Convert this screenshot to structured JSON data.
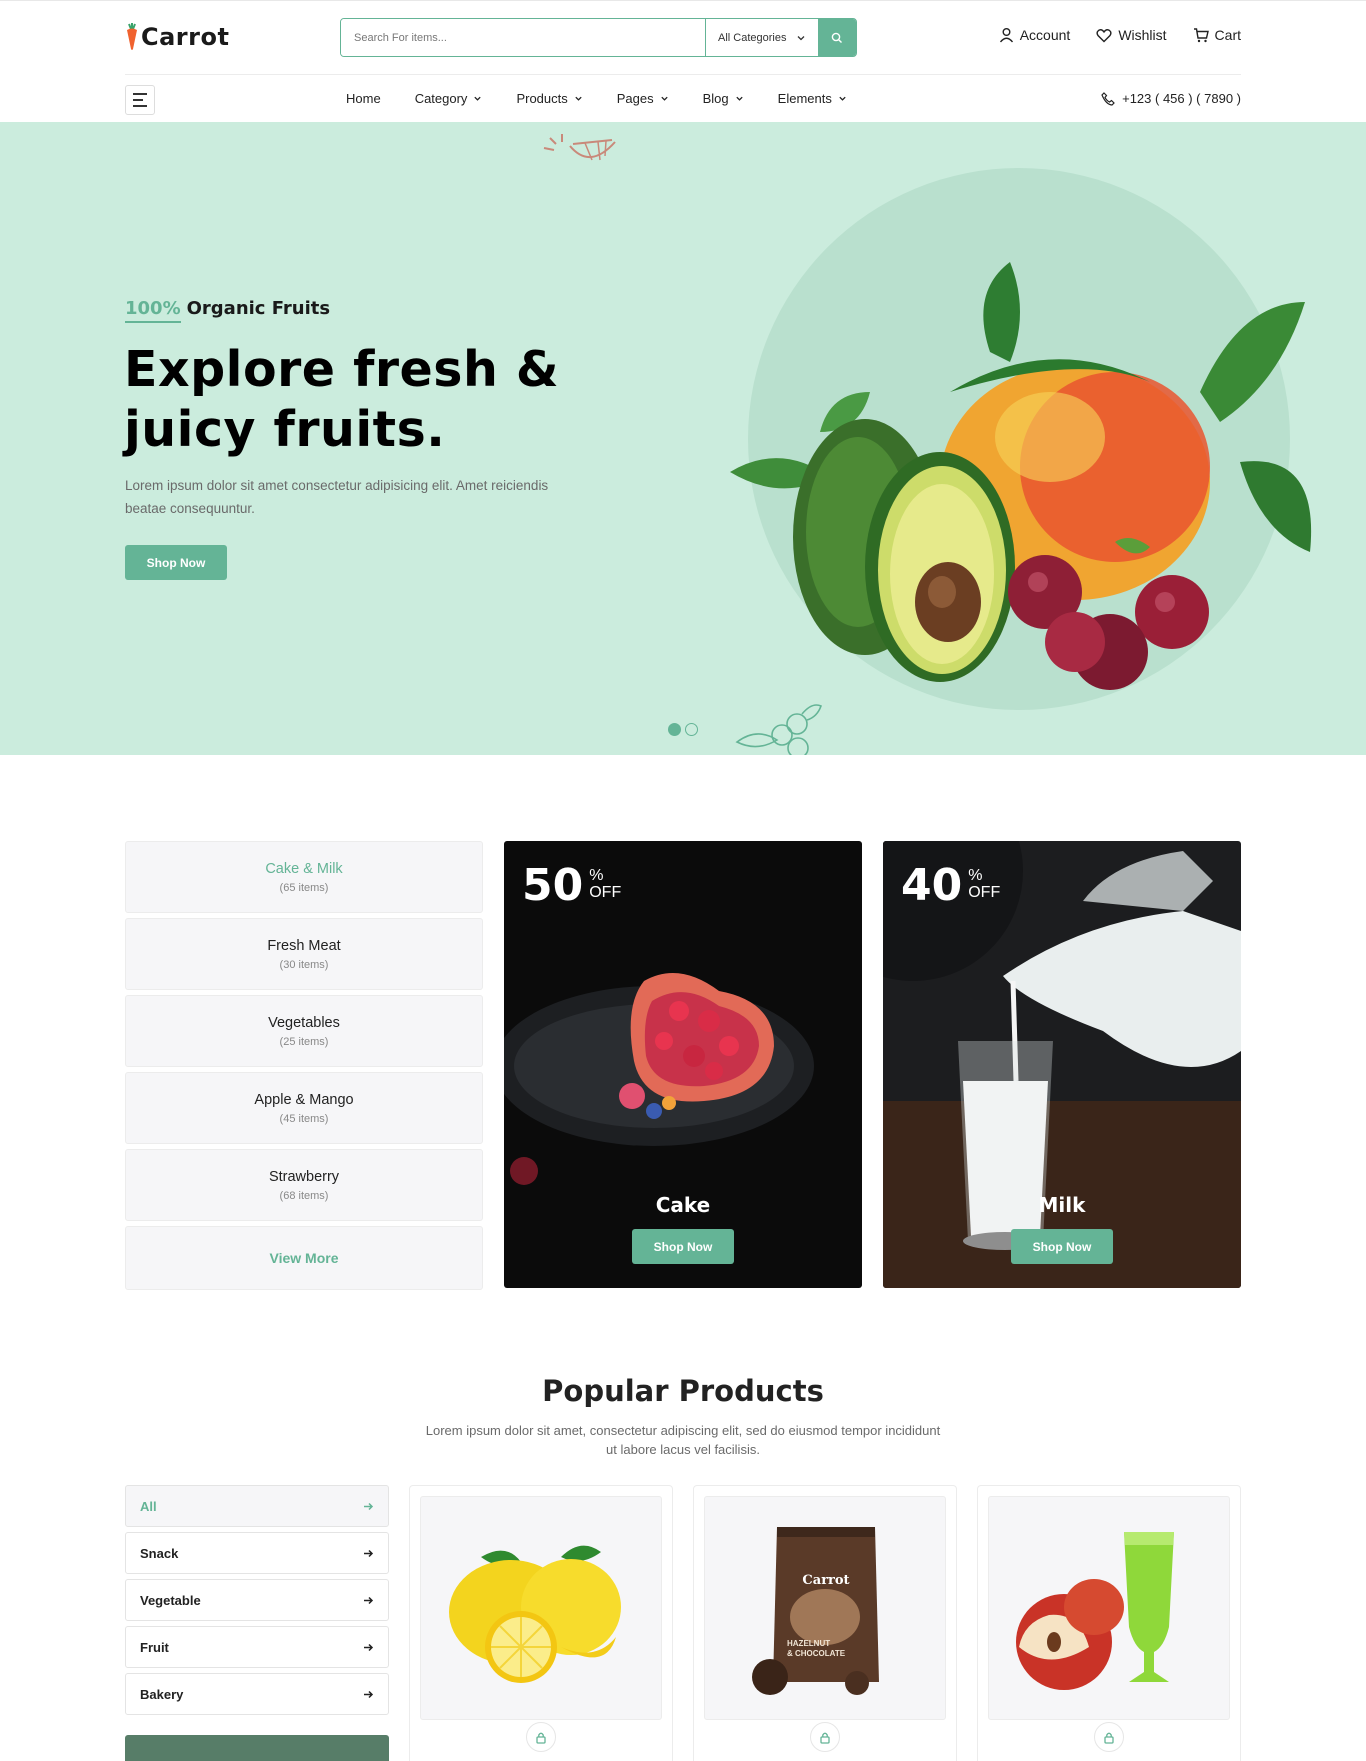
{
  "brand": {
    "name": "Carrot",
    "accent": "#64b496",
    "hero_bg": "#cbecdd"
  },
  "search": {
    "placeholder": "Search For items...",
    "category": "All Categories"
  },
  "header_links": [
    {
      "label": "Account",
      "icon": "user-icon"
    },
    {
      "label": "Wishlist",
      "icon": "heart-icon"
    },
    {
      "label": "Cart",
      "icon": "cart-icon"
    }
  ],
  "nav": {
    "items": [
      {
        "label": "Home",
        "dropdown": false
      },
      {
        "label": "Category",
        "dropdown": true
      },
      {
        "label": "Products",
        "dropdown": true
      },
      {
        "label": "Pages",
        "dropdown": true
      },
      {
        "label": "Blog",
        "dropdown": true
      },
      {
        "label": "Elements",
        "dropdown": true
      }
    ],
    "phone": "+123 ( 456 ) ( 7890 )"
  },
  "hero": {
    "tag_pct": "100%",
    "tag_text": "Organic Fruits",
    "title_line1": "Explore fresh &",
    "title_line2": "juicy fruits.",
    "desc": "Lorem ipsum dolor sit amet consectetur adipisicing elit. Amet reiciendis beatae consequuntur.",
    "button": "Shop Now",
    "slides_total": 2,
    "slide_active": 1
  },
  "categories": [
    {
      "name": "Cake & Milk",
      "count": "(65 items)",
      "active": true
    },
    {
      "name": "Fresh Meat",
      "count": "(30 items)",
      "active": false
    },
    {
      "name": "Vegetables",
      "count": "(25 items)",
      "active": false
    },
    {
      "name": "Apple & Mango",
      "count": "(45 items)",
      "active": false
    },
    {
      "name": "Strawberry",
      "count": "(68 items)",
      "active": false
    }
  ],
  "categories_more": "View More",
  "promos": [
    {
      "pct": "50",
      "sym": "%",
      "off": "OFF",
      "title": "Cake",
      "button": "Shop Now"
    },
    {
      "pct": "40",
      "sym": "%",
      "off": "OFF",
      "title": "Milk",
      "button": "Shop Now"
    }
  ],
  "popular": {
    "title": "Popular Products",
    "subtitle": "Lorem ipsum dolor sit amet, consectetur adipiscing elit, sed do eiusmod tempor incididunt ut labore lacus vel facilisis.",
    "filters": [
      {
        "label": "All",
        "active": true
      },
      {
        "label": "Snack",
        "active": false
      },
      {
        "label": "Vegetable",
        "active": false
      },
      {
        "label": "Fruit",
        "active": false
      },
      {
        "label": "Bakery",
        "active": false
      }
    ],
    "products": [
      {
        "image": "lemon-image"
      },
      {
        "image": "chocolate-pouch-image",
        "pouch_brand": "Carrot",
        "pouch_text1": "HAZELNUT",
        "pouch_text2": "& CHOCOLATE"
      },
      {
        "image": "green-juice-image"
      }
    ]
  }
}
